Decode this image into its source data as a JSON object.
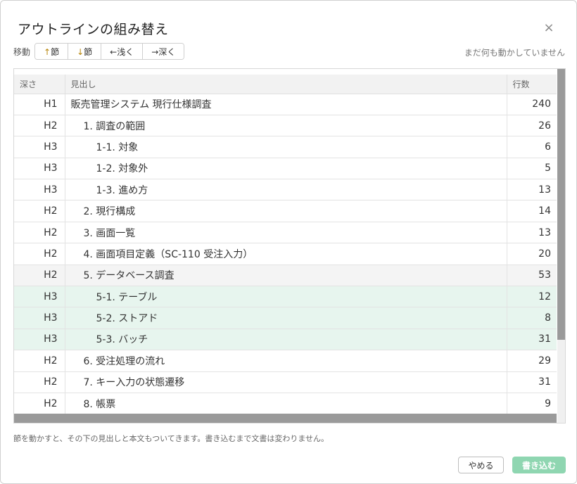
{
  "dialog": {
    "title": "アウトラインの組み替え",
    "close_glyph": "×",
    "close_icon": "close-icon"
  },
  "toolbar": {
    "label": "移動",
    "buttons": [
      {
        "arrow": "↑",
        "text": "節"
      },
      {
        "arrow": "↓",
        "text": "節"
      },
      {
        "arrow": "←",
        "text": "浅く"
      },
      {
        "arrow": "→",
        "text": "深く"
      }
    ],
    "status": "まだ何も動かしていません"
  },
  "table": {
    "headers": [
      "深さ",
      "見出し",
      "行数"
    ],
    "rows": [
      {
        "depth": "H1",
        "heading": "販売管理システム 現行仕様調査",
        "count": "240",
        "state": ""
      },
      {
        "depth": "H2",
        "heading": "1. 調査の範囲",
        "count": "26",
        "state": ""
      },
      {
        "depth": "H3",
        "heading": "1-1. 対象",
        "count": "6",
        "state": ""
      },
      {
        "depth": "H3",
        "heading": "1-2. 対象外",
        "count": "5",
        "state": ""
      },
      {
        "depth": "H3",
        "heading": "1-3. 進め方",
        "count": "13",
        "state": ""
      },
      {
        "depth": "H2",
        "heading": "2. 現行構成",
        "count": "14",
        "state": ""
      },
      {
        "depth": "H2",
        "heading": "3. 画面一覧",
        "count": "13",
        "state": ""
      },
      {
        "depth": "H2",
        "heading": "4. 画面項目定義（SC-110 受注入力）",
        "count": "20",
        "state": ""
      },
      {
        "depth": "H2",
        "heading": "5. データベース調査",
        "count": "53",
        "state": "selected"
      },
      {
        "depth": "H3",
        "heading": "5-1. テーブル",
        "count": "12",
        "state": "child"
      },
      {
        "depth": "H3",
        "heading": "5-2. ストアド",
        "count": "8",
        "state": "child"
      },
      {
        "depth": "H3",
        "heading": "5-3. バッチ",
        "count": "31",
        "state": "child"
      },
      {
        "depth": "H2",
        "heading": "6. 受注処理の流れ",
        "count": "29",
        "state": ""
      },
      {
        "depth": "H2",
        "heading": "7. キー入力の状態遷移",
        "count": "31",
        "state": ""
      },
      {
        "depth": "H2",
        "heading": "8. 帳票",
        "count": "9",
        "state": ""
      }
    ]
  },
  "footer": {
    "hint": "節を動かすと、その下の見出しと本文もついてきます。書き込むまで文書は変わりません。",
    "cancel_label": "やめる",
    "write_label": "書き込む"
  },
  "colors": {
    "selected_row": "#f4f4f4",
    "child_row": "#e7f5ee",
    "primary_button": "#8fd6b1",
    "arrow": "#b8860b"
  }
}
